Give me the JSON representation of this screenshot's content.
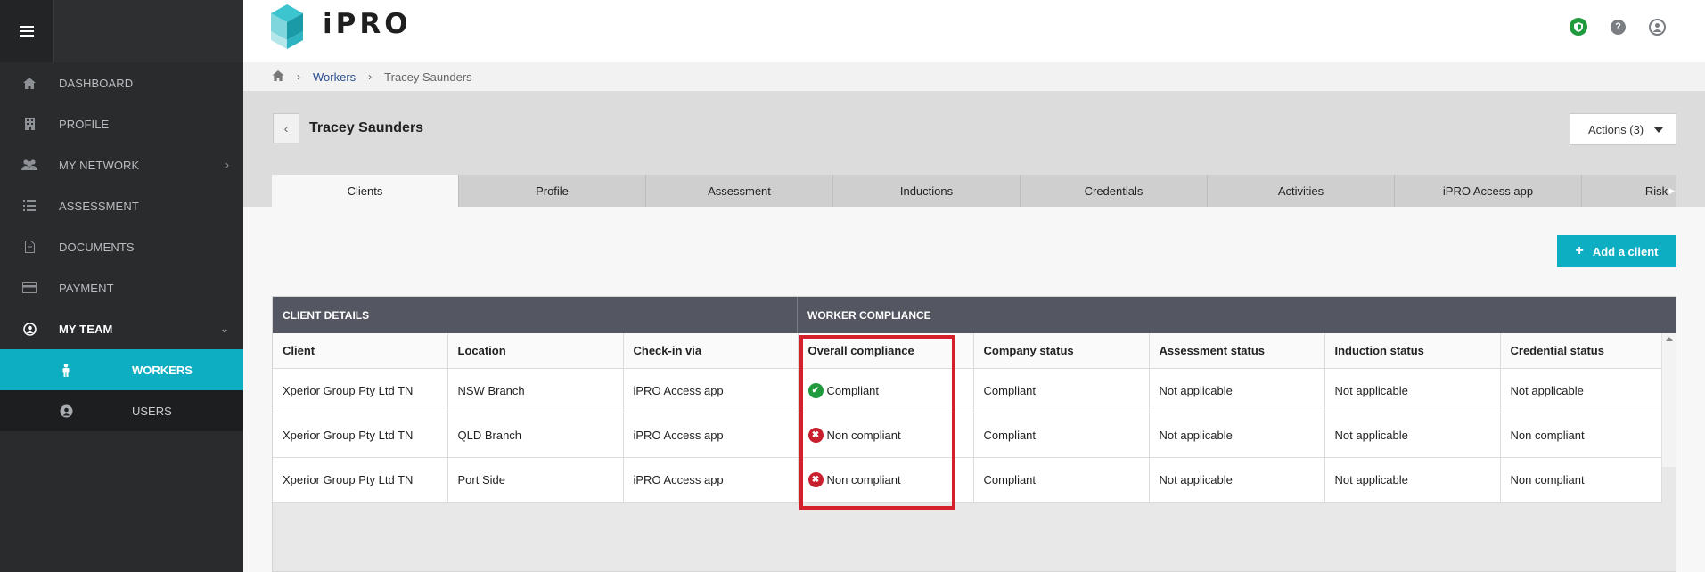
{
  "brand": {
    "logo_text": "iPRO"
  },
  "sidebar": {
    "items": [
      {
        "label": "DASHBOARD",
        "icon": "home-icon"
      },
      {
        "label": "PROFILE",
        "icon": "building-icon"
      },
      {
        "label": "MY NETWORK",
        "icon": "group-icon"
      },
      {
        "label": "ASSESSMENT",
        "icon": "list-icon"
      },
      {
        "label": "DOCUMENTS",
        "icon": "document-icon"
      },
      {
        "label": "PAYMENT",
        "icon": "credit-card-icon"
      },
      {
        "label": "MY TEAM",
        "icon": "user-circle-icon"
      }
    ],
    "subitems": [
      {
        "label": "WORKERS",
        "icon": "person-icon",
        "active": true
      },
      {
        "label": "USERS",
        "icon": "user-circle-icon",
        "active": false
      }
    ]
  },
  "header": {
    "icons": [
      "shield-icon",
      "help-icon",
      "user-icon"
    ]
  },
  "breadcrumb": {
    "items": [
      "Workers",
      "Tracey Saunders"
    ]
  },
  "page": {
    "worker_name": "Tracey Saunders",
    "actions_label": "Actions (3)",
    "add_client_label": "Add a client"
  },
  "tabs": [
    "Clients",
    "Profile",
    "Assessment",
    "Inductions",
    "Credentials",
    "Activities",
    "iPRO Access app",
    "Risks and c"
  ],
  "active_tab": "Clients",
  "table": {
    "groups": [
      "CLIENT DETAILS",
      "WORKER COMPLIANCE"
    ],
    "columns": [
      "Client",
      "Location",
      "Check-in via",
      "Overall compliance",
      "Company status",
      "Assessment status",
      "Induction status",
      "Credential status"
    ],
    "rows": [
      {
        "client": "Xperior Group Pty Ltd TN",
        "location": "NSW Branch",
        "checkin": "iPRO Access app",
        "overall": "Compliant",
        "overall_ok": true,
        "company": "Compliant",
        "assessment": "Not applicable",
        "induction": "Not applicable",
        "credential": "Not applicable"
      },
      {
        "client": "Xperior Group Pty Ltd TN",
        "location": "QLD Branch",
        "checkin": "iPRO Access app",
        "overall": "Non compliant",
        "overall_ok": false,
        "company": "Compliant",
        "assessment": "Not applicable",
        "induction": "Not applicable",
        "credential": "Non compliant"
      },
      {
        "client": "Xperior Group Pty Ltd TN",
        "location": "Port Side",
        "checkin": "iPRO Access app",
        "overall": "Non compliant",
        "overall_ok": false,
        "company": "Compliant",
        "assessment": "Not applicable",
        "induction": "Not applicable",
        "credential": "Non compliant"
      }
    ]
  },
  "colors": {
    "accent": "#0eaec2",
    "ok": "#1f9a3d",
    "bad": "#c8202e",
    "highlight": "#d4202a",
    "sidebar": "#2a2b2d"
  }
}
